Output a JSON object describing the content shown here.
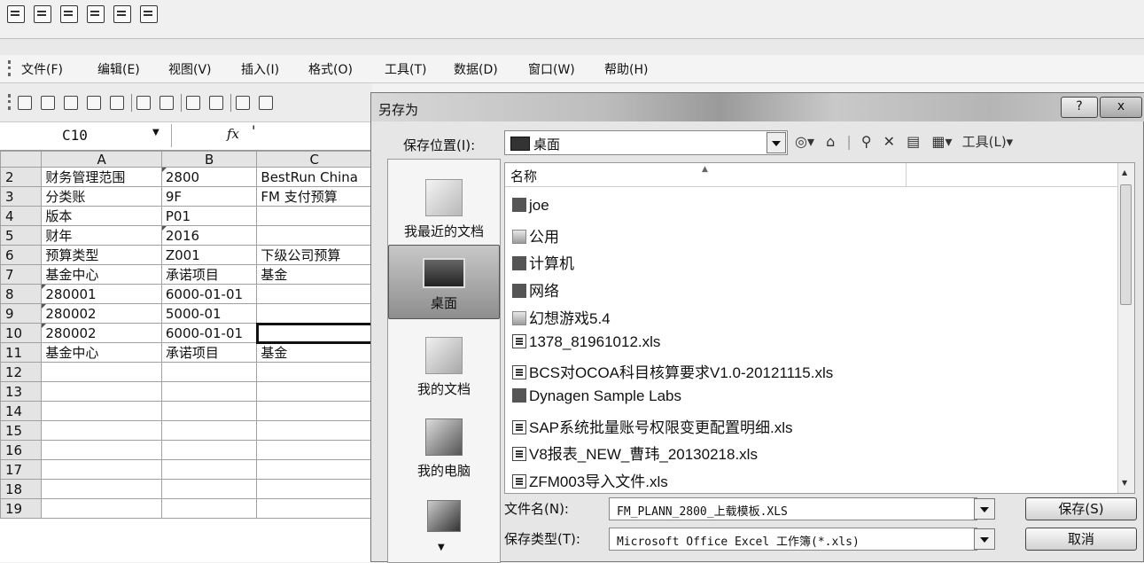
{
  "toolbar_icons": [
    "save-as-icon",
    "export-icon",
    "share-icon",
    "delete-icon",
    "refresh-icon",
    "edit-icon"
  ],
  "menubar": {
    "items": [
      "文件(F)",
      "编辑(E)",
      "视图(V)",
      "插入(I)",
      "格式(O)",
      "工具(T)",
      "数据(D)",
      "窗口(W)",
      "帮助(H)"
    ]
  },
  "formula_bar": {
    "name_box": "C10",
    "fx_label": "fx",
    "content": "'"
  },
  "sheet": {
    "columns": [
      "A",
      "B",
      "C"
    ],
    "rows": [
      {
        "n": "2",
        "a": "财务管理范围",
        "b": "2800",
        "c": "BestRun China"
      },
      {
        "n": "3",
        "a": "分类账",
        "b": "9F",
        "c": "FM 支付预算"
      },
      {
        "n": "4",
        "a": "版本",
        "b": "P01",
        "c": ""
      },
      {
        "n": "5",
        "a": "财年",
        "b": "2016",
        "c": ""
      },
      {
        "n": "6",
        "a": "预算类型",
        "b": "Z001",
        "c": "下级公司预算"
      },
      {
        "n": "7",
        "a": "基金中心",
        "b": "承诺项目",
        "c": "基金"
      },
      {
        "n": "8",
        "a": "280001",
        "b": "6000-01-01",
        "c": ""
      },
      {
        "n": "9",
        "a": "280002",
        "b": "5000-01",
        "c": ""
      },
      {
        "n": "10",
        "a": "280002",
        "b": "6000-01-01",
        "c": ""
      },
      {
        "n": "11",
        "a": "基金中心",
        "b": "承诺项目",
        "c": "基金"
      },
      {
        "n": "12",
        "a": "",
        "b": "",
        "c": ""
      },
      {
        "n": "13",
        "a": "",
        "b": "",
        "c": ""
      },
      {
        "n": "14",
        "a": "",
        "b": "",
        "c": ""
      },
      {
        "n": "15",
        "a": "",
        "b": "",
        "c": ""
      },
      {
        "n": "16",
        "a": "",
        "b": "",
        "c": ""
      },
      {
        "n": "17",
        "a": "",
        "b": "",
        "c": ""
      },
      {
        "n": "18",
        "a": "",
        "b": "",
        "c": ""
      },
      {
        "n": "19",
        "a": "",
        "b": "",
        "c": ""
      }
    ]
  },
  "dialog": {
    "title": "另存为",
    "help_btn": "?",
    "close_btn": "x",
    "location_label": "保存位置(I):",
    "location_value": "桌面",
    "tools_label": "工具(L)▾",
    "column_name": "名称",
    "places": [
      {
        "label": "我最近的文档",
        "icon": "recent-docs-icon"
      },
      {
        "label": "桌面",
        "icon": "desktop-icon"
      },
      {
        "label": "我的文档",
        "icon": "my-documents-icon"
      },
      {
        "label": "我的电脑",
        "icon": "my-computer-icon"
      },
      {
        "label": "",
        "icon": "network-places-icon"
      }
    ],
    "files": [
      {
        "name": "joe",
        "icon": "user-folder-icon"
      },
      {
        "name": "公用",
        "icon": "folder-icon"
      },
      {
        "name": "计算机",
        "icon": "computer-icon"
      },
      {
        "name": "网络",
        "icon": "network-icon"
      },
      {
        "name": "幻想游戏5.4",
        "icon": "folder-icon"
      },
      {
        "name": "1378_81961012.xls",
        "icon": "excel-file-icon"
      },
      {
        "name": "BCS对OCOA科目核算要求V1.0-20121115.xls",
        "icon": "excel-file-icon"
      },
      {
        "name": "Dynagen Sample Labs",
        "icon": "shortcut-icon"
      },
      {
        "name": "SAP系统批量账号权限变更配置明细.xls",
        "icon": "excel-file-icon"
      },
      {
        "name": "V8报表_NEW_曹玮_20130218.xls",
        "icon": "excel-file-icon"
      },
      {
        "name": "ZFM003导入文件.xls",
        "icon": "excel-file-icon"
      }
    ],
    "filename_label": "文件名(N):",
    "filename_value": "FM_PLANN_2800_上载模板.XLS",
    "filetype_label": "保存类型(T):",
    "filetype_value": "Microsoft Office Excel 工作簿(*.xls)",
    "save_button": "保存(S)",
    "cancel_button": "取消"
  }
}
